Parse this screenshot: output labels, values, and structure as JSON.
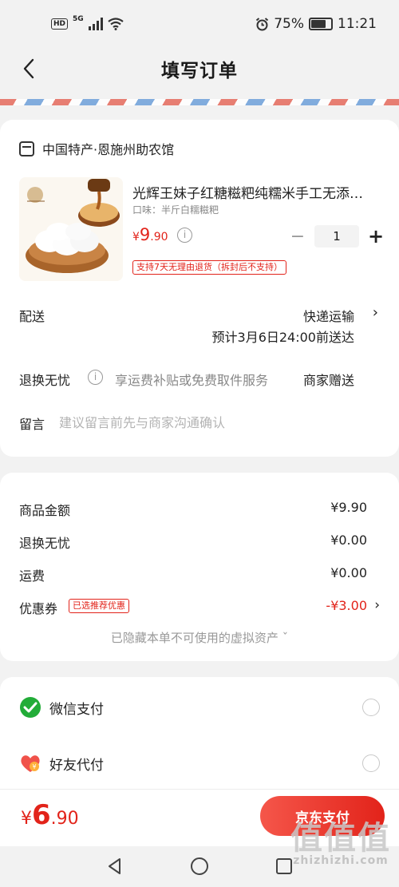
{
  "status_bar": {
    "network": "5G",
    "battery": "75%",
    "battery_level": 0.75,
    "time": "11:21"
  },
  "header": {
    "title": "填写订单"
  },
  "shop": {
    "name": "中国特产·恩施州助农馆"
  },
  "product": {
    "title": "光辉王妹子红糖糍粑纯糯米手工无添…",
    "spec": "口味：半斤白糯糍粑",
    "price_currency": "¥",
    "price_int": "9",
    "price_dec": ".90",
    "quantity": "1",
    "minus": "−",
    "plus": "+",
    "return_tag": "支持7天无理由退货（拆封后不支持）"
  },
  "delivery": {
    "label": "配送",
    "method": "快递运输",
    "eta": "预计3月6日24:00前送达"
  },
  "guarantee": {
    "label": "退换无忧",
    "desc": "享运费补贴或免费取件服务",
    "value": "商家赠送"
  },
  "remark": {
    "label": "留言",
    "placeholder": "建议留言前先与商家沟通确认"
  },
  "summary": {
    "goods_label": "商品金额",
    "goods_value": "¥9.90",
    "guarantee_label": "退换无忧",
    "guarantee_value": "¥0.00",
    "shipping_label": "运费",
    "shipping_value": "¥0.00",
    "coupon_label": "优惠券",
    "coupon_tag": "已选推荐优惠",
    "coupon_value": "-¥3.00",
    "hidden_note": "已隐藏本单不可使用的虚拟资产 ˇ"
  },
  "payment": {
    "wechat_label": "微信支付",
    "friend_label": "好友代付"
  },
  "bottom": {
    "total_currency": "¥",
    "total_int": "6",
    "total_dec": ".90",
    "pay_button": "京东支付"
  },
  "watermark": {
    "main": "值值值",
    "sub": "zhizhizhi.com"
  },
  "colors": {
    "accent": "#e2231a",
    "wechat": "#22ac38"
  }
}
